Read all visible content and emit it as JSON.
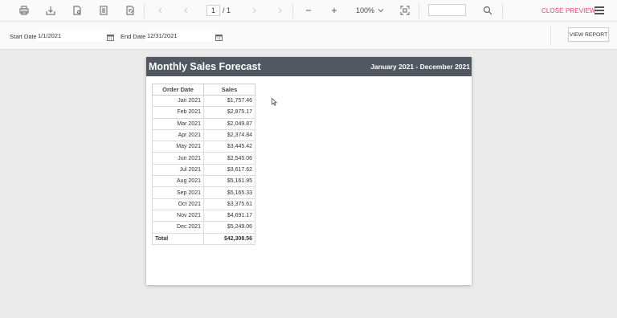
{
  "toolbar": {
    "page_current": "1",
    "page_total": "/ 1",
    "zoom": "100%",
    "close_preview": "CLOSE PREVIEW"
  },
  "params": {
    "start_label": "Start Date",
    "start_value": "1/1/2021",
    "end_label": "End Date",
    "end_value": "12/31/2021",
    "view_report": "VIEW REPORT"
  },
  "report": {
    "title": "Monthly Sales Forecast",
    "range": "January 2021 - December 2021",
    "columns": [
      "Order Date",
      "Sales"
    ],
    "rows": [
      {
        "date": "Jan 2021",
        "sales": "$1,757.46"
      },
      {
        "date": "Feb 2021",
        "sales": "$2,875.17"
      },
      {
        "date": "Mar 2021",
        "sales": "$2,049.87"
      },
      {
        "date": "Apr 2021",
        "sales": "$2,374.84"
      },
      {
        "date": "May 2021",
        "sales": "$3,445.42"
      },
      {
        "date": "Jun 2021",
        "sales": "$2,545.06"
      },
      {
        "date": "Jul 2021",
        "sales": "$3,617.62"
      },
      {
        "date": "Aug 2021",
        "sales": "$5,161.95"
      },
      {
        "date": "Sep 2021",
        "sales": "$5,165.33"
      },
      {
        "date": "Oct 2021",
        "sales": "$3,375.61"
      },
      {
        "date": "Nov 2021",
        "sales": "$4,691.17"
      },
      {
        "date": "Dec 2021",
        "sales": "$5,249.06"
      }
    ],
    "total_label": "Total",
    "total_value": "$42,308.56"
  },
  "colors": {
    "header_bg": "#515861",
    "accent": "#e8426b"
  }
}
